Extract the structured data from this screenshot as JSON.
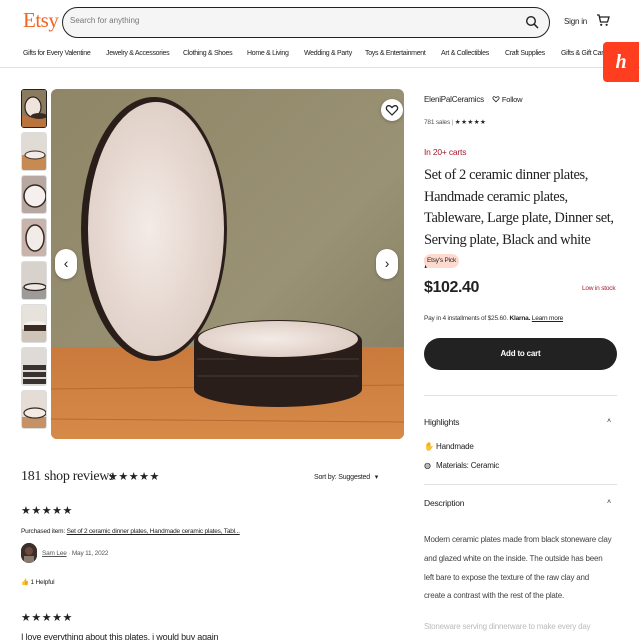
{
  "header": {
    "logo": "Etsy",
    "search_placeholder": "Search for anything",
    "signin": "Sign in",
    "nav": [
      "Gifts for Every Valentine",
      "Jewelry & Accessories",
      "Clothing & Shoes",
      "Home & Living",
      "Wedding & Party",
      "Toys & Entertainment",
      "Art & Collectibles",
      "Craft Supplies",
      "Gifts & Gift Cards"
    ],
    "honey_label": "h"
  },
  "shop": {
    "name": "EleniPalCeramics",
    "follow": "Follow",
    "sales": "781 sales",
    "rating_stars": "★★★★★"
  },
  "listing": {
    "carts": "In 20+ carts",
    "title": "Set of 2 ceramic dinner plates, Handmade ceramic plates, Tableware, Large plate, Dinner set, Serving plate, Black and white plate",
    "pick_badge": "Etsy's Pick",
    "price": "$102.40",
    "stock": "Low in stock",
    "klarna_text": "Pay in 4 installments of $25.60.",
    "klarna_brand": "Klarna.",
    "klarna_link": "Learn more",
    "add_to_cart": "Add to cart"
  },
  "highlights": {
    "heading": "Highlights",
    "items": [
      "Handmade",
      "Materials: Ceramic"
    ]
  },
  "description": {
    "heading": "Description",
    "lines": [
      "Modern ceramic plates made from black stoneware clay",
      "and glazed white on the inside. The outside has been",
      "left bare to expose the texture of the raw clay and",
      "create a contrast with the rest of the plate."
    ],
    "fade_line": "Stoneware serving dinnerware to make every day"
  },
  "reviews": {
    "heading": "181 shop reviews",
    "stars": "★★★★★",
    "sort_label": "Sort by: Suggested",
    "review1": {
      "stars": "★★★★★",
      "purchased_label": "Purchased item:",
      "purchased_item": "Set of 2 ceramic dinner plates, Handmade ceramic plates, Tabl...",
      "reviewer": "Sam Lee",
      "date": "May 11, 2022",
      "helpful": "1 Helpful"
    },
    "review2": {
      "stars": "★★★★★",
      "text": "I love everything about this plates, i would buy again"
    }
  },
  "colors": {
    "brand": "#f1641e",
    "price_accent": "#a61a2e",
    "honey": "#ff3e1f",
    "button_dark": "#222222"
  }
}
